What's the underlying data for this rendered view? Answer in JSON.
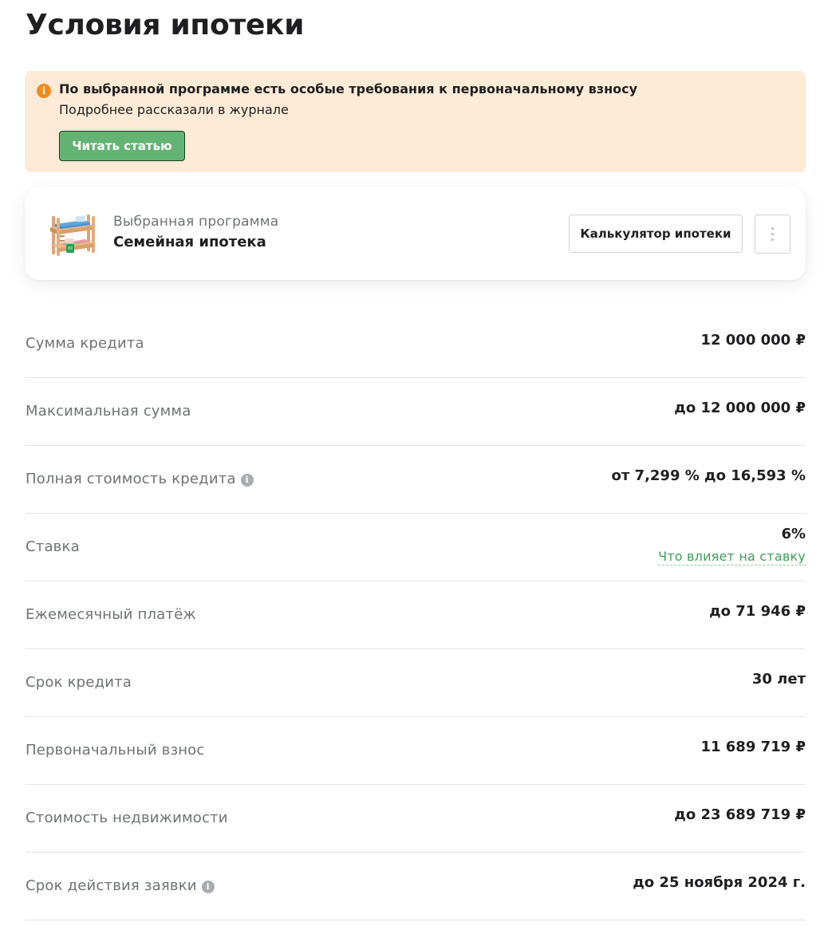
{
  "page_title": "Условия ипотеки",
  "alert": {
    "icon": "info-icon",
    "color": "#fdebd7",
    "title": "По выбранной программе есть особые требования к первоначальному взносу",
    "text": "Подробнее рассказали в журнале",
    "button_label": "Читать статью"
  },
  "program": {
    "image": "bunk-bed-illustration",
    "caption": "Выбранная программа",
    "name": "Семейная ипотека",
    "calculator_button": "Калькулятор ипотеки",
    "more_icon": "more-vertical-icon"
  },
  "conditions": [
    {
      "label": "Сумма кредита",
      "value": "12 000 000 ₽"
    },
    {
      "label": "Максимальная сумма",
      "value": "до 12 000 000 ₽"
    },
    {
      "label": "Полная стоимость кредита",
      "value": "от 7,299 % до 16,593 %",
      "info": true
    },
    {
      "label": "Ставка",
      "value": "6%",
      "link": "Что влияет на ставку"
    },
    {
      "label": "Ежемесячный платёж",
      "value": "до 71 946 ₽"
    },
    {
      "label": "Срок кредита",
      "value": "30 лет"
    },
    {
      "label": "Первоначальный взнос",
      "value": "11 689 719 ₽"
    },
    {
      "label": "Стоимость недвижимости",
      "value": "до 23 689 719 ₽"
    },
    {
      "label": "Срок действия заявки",
      "value": "до 25 ноября 2024 г.",
      "info": true
    }
  ],
  "colors": {
    "accent_green": "#63b374",
    "link_green": "#3f9f58",
    "alert_icon": "#f08a1c"
  }
}
